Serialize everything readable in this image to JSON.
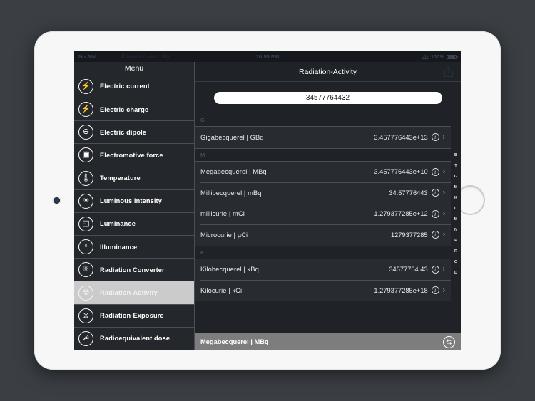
{
  "status_bar": {
    "carrier": "No SIM",
    "ghost_title": "Kinematic viscosity",
    "time": "10:53 PM",
    "wifi_icon": "wifi-icon",
    "battery_percent": "100%",
    "battery_icon": "battery-full-icon"
  },
  "sidebar": {
    "header": "Menu",
    "items": [
      {
        "label": "Electric current",
        "icon": "lightning-bolt-icon",
        "glyph": "⚡",
        "selected": false
      },
      {
        "label": "Electric charge",
        "icon": "battery-charge-icon",
        "glyph": "⚡",
        "selected": false
      },
      {
        "label": "Electric dipole",
        "icon": "dipole-icon",
        "glyph": "⊖",
        "selected": false
      },
      {
        "label": "Electromotive force",
        "icon": "generator-icon",
        "glyph": "▣",
        "selected": false
      },
      {
        "label": "Temperature",
        "icon": "thermometer-icon",
        "glyph": "🌡",
        "selected": false
      },
      {
        "label": "Luminous intensity",
        "icon": "lightbulb-icon",
        "glyph": "☀",
        "selected": false
      },
      {
        "label": "Luminance",
        "icon": "square-overlap-icon",
        "glyph": "◱",
        "selected": false
      },
      {
        "label": "Illuminance",
        "icon": "lamp-icon",
        "glyph": "♀",
        "selected": false
      },
      {
        "label": "Radiation Converter",
        "icon": "atom-icon",
        "glyph": "⚛",
        "selected": false
      },
      {
        "label": "Radiation-Activity",
        "icon": "radioactive-icon",
        "glyph": "☢",
        "selected": true
      },
      {
        "label": "Radiation-Exposure",
        "icon": "hourglass-icon",
        "glyph": "⧖",
        "selected": false
      },
      {
        "label": "Radioequivalent dose",
        "icon": "dose-icon",
        "glyph": "☭",
        "selected": false
      }
    ]
  },
  "main": {
    "title": "Radiation-Activity",
    "share_icon": "share-icon",
    "input": {
      "value": "34577764432",
      "placeholder": ""
    },
    "sections": [
      {
        "letter": "G",
        "rows": [
          {
            "name": "Gigabecquerel | GBq",
            "value": "3.457776443e+13",
            "info_icon": "info-icon",
            "chevron_icon": "chevron-right-icon"
          }
        ]
      },
      {
        "letter": "M",
        "rows": [
          {
            "name": "Megabecquerel | MBq",
            "value": "3.457776443e+10",
            "info_icon": "info-icon",
            "chevron_icon": "chevron-right-icon"
          },
          {
            "name": "Millibecquerel | mBq",
            "value": "34.57776443",
            "info_icon": "info-icon",
            "chevron_icon": "chevron-right-icon"
          },
          {
            "name": "millicurie | mCi",
            "value": "1.279377285e+12",
            "info_icon": "info-icon",
            "chevron_icon": "chevron-right-icon"
          },
          {
            "name": "Microcurie | µCi",
            "value": "1279377285",
            "info_icon": "info-icon",
            "chevron_icon": "chevron-right-icon"
          }
        ]
      },
      {
        "letter": "K",
        "rows": [
          {
            "name": "Kilobecquerel | kBq",
            "value": "34577764.43",
            "info_icon": "info-icon",
            "chevron_icon": "chevron-right-icon"
          },
          {
            "name": "Kilocurie | kCi",
            "value": "1.279377285e+18",
            "info_icon": "info-icon",
            "chevron_icon": "chevron-right-icon"
          }
        ]
      }
    ],
    "index_letters": [
      "B",
      "T",
      "G",
      "M",
      "K",
      "C",
      "M",
      "N",
      "P",
      "R",
      "O",
      "D"
    ]
  },
  "footer": {
    "label": "Megabecquerel | MBq",
    "swap_icon": "swap-arrows-icon"
  },
  "device": {
    "camera": "front-camera-dot",
    "home_button": "home-button"
  },
  "colors": {
    "screen_bg": "#1f2227",
    "sidebar_bg": "#24272c",
    "row_bg": "#282c31",
    "selected_bg": "#cbcbcb",
    "footer_bg": "#7d7d7d",
    "divider": "#4a4f57",
    "text": "#ffffff"
  }
}
